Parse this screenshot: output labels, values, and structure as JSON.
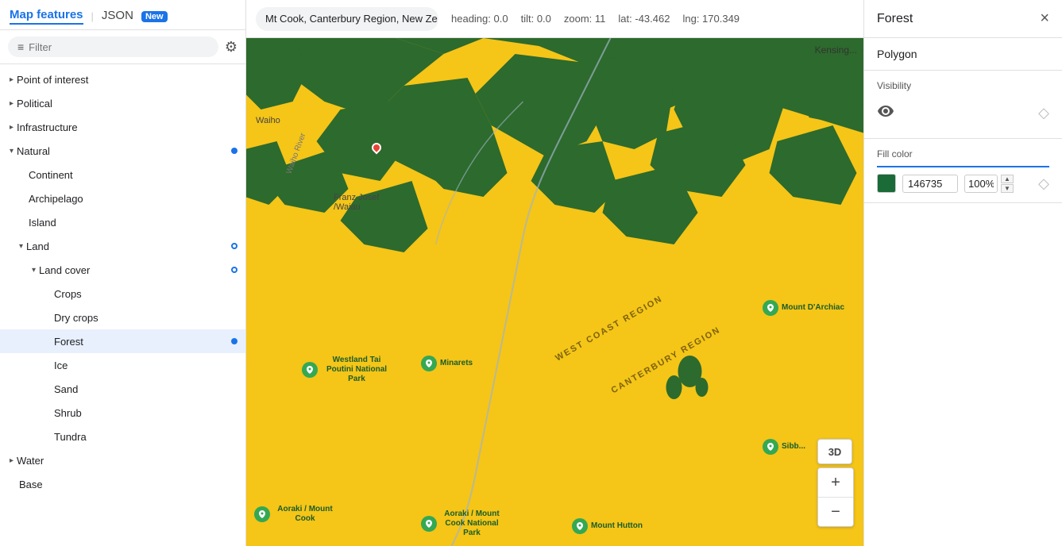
{
  "sidebar": {
    "tab_map_features": "Map features",
    "tab_json": "JSON",
    "tab_new_badge": "New",
    "filter_placeholder": "Filter",
    "tree": [
      {
        "id": "point-of-interest",
        "label": "Point of interest",
        "level": 0,
        "has_caret": true,
        "caret_dir": "right",
        "dot": null
      },
      {
        "id": "political",
        "label": "Political",
        "level": 0,
        "has_caret": true,
        "caret_dir": "right",
        "dot": null
      },
      {
        "id": "infrastructure",
        "label": "Infrastructure",
        "level": 0,
        "has_caret": true,
        "caret_dir": "right",
        "dot": null
      },
      {
        "id": "natural",
        "label": "Natural",
        "level": 0,
        "has_caret": true,
        "caret_dir": "down",
        "dot": "filled"
      },
      {
        "id": "continent",
        "label": "Continent",
        "level": 1,
        "has_caret": false,
        "dot": null
      },
      {
        "id": "archipelago",
        "label": "Archipelago",
        "level": 1,
        "has_caret": false,
        "dot": null
      },
      {
        "id": "island",
        "label": "Island",
        "level": 1,
        "has_caret": false,
        "dot": null
      },
      {
        "id": "land",
        "label": "Land",
        "level": 1,
        "has_caret": true,
        "caret_dir": "down",
        "dot": "outline"
      },
      {
        "id": "land-cover",
        "label": "Land cover",
        "level": 2,
        "has_caret": true,
        "caret_dir": "down",
        "dot": "outline"
      },
      {
        "id": "crops",
        "label": "Crops",
        "level": 3,
        "has_caret": false,
        "dot": null
      },
      {
        "id": "dry-crops",
        "label": "Dry crops",
        "level": 3,
        "has_caret": false,
        "dot": null
      },
      {
        "id": "forest",
        "label": "Forest",
        "level": 3,
        "has_caret": false,
        "dot": "filled",
        "selected": true
      },
      {
        "id": "ice",
        "label": "Ice",
        "level": 3,
        "has_caret": false,
        "dot": null
      },
      {
        "id": "sand",
        "label": "Sand",
        "level": 3,
        "has_caret": false,
        "dot": null
      },
      {
        "id": "shrub",
        "label": "Shrub",
        "level": 3,
        "has_caret": false,
        "dot": null
      },
      {
        "id": "tundra",
        "label": "Tundra",
        "level": 3,
        "has_caret": false,
        "dot": null
      },
      {
        "id": "water",
        "label": "Water",
        "level": 0,
        "has_caret": true,
        "caret_dir": "right",
        "dot": null
      },
      {
        "id": "base",
        "label": "Base",
        "level": 0,
        "has_caret": false,
        "dot": null
      }
    ]
  },
  "map": {
    "location": "Mt Cook, Canterbury Region, New Ze",
    "heading": "0.0",
    "tilt": "0.0",
    "zoom": "11",
    "lat": "-43.462",
    "lng": "170.349",
    "heading_label": "heading:",
    "tilt_label": "tilt:",
    "zoom_label": "zoom:",
    "lat_label": "lat:",
    "lng_label": "lng:",
    "btn_3d": "3D",
    "btn_zoom_in": "+",
    "btn_zoom_out": "−"
  },
  "right_panel": {
    "title": "Forest",
    "close_label": "×",
    "polygon_label": "Polygon",
    "visibility_label": "Visibility",
    "fill_color_label": "Fill color",
    "color_hex": "146735",
    "opacity_value": "100%",
    "diamond_label": "◇"
  }
}
